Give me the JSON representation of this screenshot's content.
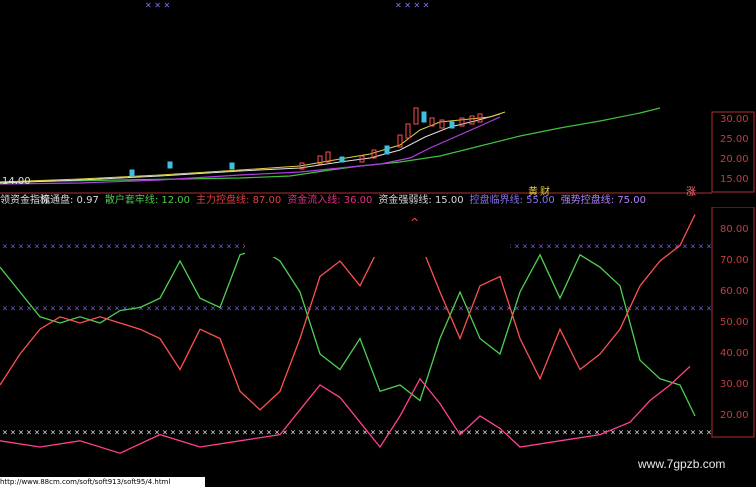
{
  "top_chart": {
    "y_ticks": [
      "30.00",
      "25.00",
      "20.00",
      "15.00"
    ],
    "left_price": "14.00",
    "tags": [
      "黄",
      "财",
      "涨"
    ]
  },
  "indicator": {
    "title": "领资金指标",
    "params": [
      {
        "label": "流通盘: 0.97",
        "color": "#d8d8d8"
      },
      {
        "label": "散户套牢线: 12.00",
        "color": "#50c850"
      },
      {
        "label": "主力控盘线: 87.00",
        "color": "#e04040"
      },
      {
        "label": "资金流入线: 36.00",
        "color": "#e03080"
      },
      {
        "label": "资金强弱线: 15.00",
        "color": "#d8d8d8"
      },
      {
        "label": "控盘临界线: 55.00",
        "color": "#8a70f0"
      },
      {
        "label": "强势控盘线: 75.00",
        "color": "#b080ff"
      }
    ],
    "y_ticks": [
      "80.00",
      "70.00",
      "60.00",
      "50.00",
      "40.00",
      "30.00",
      "20.00"
    ],
    "caret": "^"
  },
  "watermark": "www.7gpzb.com",
  "status_url": "http://www.88cm.com/soft/soft913/soft95/4.html",
  "colors": {
    "axis": "#b03030",
    "green": "#50d050",
    "red": "#ff5050",
    "pink": "#ff4090",
    "violet": "#8c6cff",
    "white": "#ffffff"
  }
}
